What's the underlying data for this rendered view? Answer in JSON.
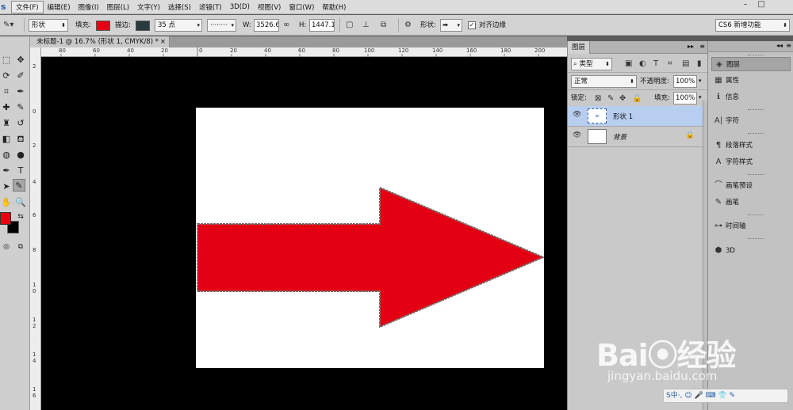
{
  "app": {
    "logo": "s"
  },
  "menu": [
    "文件(F)",
    "编辑(E)",
    "图像(I)",
    "图层(L)",
    "文字(Y)",
    "选择(S)",
    "滤镜(T)",
    "3D(D)",
    "视图(V)",
    "窗口(W)",
    "帮助(H)"
  ],
  "window_controls": [
    "–",
    "□"
  ],
  "options": {
    "mode": "形状",
    "fill_label": "填充:",
    "fill_color": "#e30012",
    "stroke_label": "描边:",
    "stroke_color": "#2a3b3f",
    "stroke_width": "35 点",
    "stroke_style": "········",
    "w_label": "W:",
    "w_value": "3526.6",
    "h_label": "H:",
    "h_value": "1447.1",
    "shape_label": "形状:",
    "align_edges_label": "对齐边缘",
    "align_edges_checked": "✓",
    "workspace": "CS6 新增功能"
  },
  "document": {
    "tab_title": "未标题-1 @ 16.7% (形状 1, CMYK/8) *",
    "close": "×",
    "ruler_top": [
      "80",
      "60",
      "40",
      "20",
      "0",
      "20",
      "40",
      "60",
      "80",
      "100",
      "120",
      "140",
      "160",
      "180",
      "200"
    ],
    "ruler_left": [
      "2",
      "0",
      "2",
      "4",
      "6",
      "8",
      "1 0",
      "1 2",
      "1 4",
      "1 6"
    ],
    "arrow_color": "#e30012"
  },
  "layers_panel": {
    "tab": "图层",
    "filter_type": "类型",
    "blend_mode": "正常",
    "opacity_label": "不透明度:",
    "opacity_value": "100%",
    "lock_label": "锁定:",
    "fill_label": "填充:",
    "fill_value": "100%",
    "layers": [
      {
        "name": "形状 1",
        "selected": true
      },
      {
        "name": "背景",
        "locked": true
      }
    ]
  },
  "dock": {
    "items": [
      {
        "icon": "layers-icon",
        "label": "图层"
      },
      {
        "icon": "properties-icon",
        "label": "属性"
      },
      {
        "icon": "info-icon",
        "label": "信息"
      },
      {
        "icon": "character-icon",
        "label": "字符"
      },
      {
        "icon": "paragraph-styles-icon",
        "label": "段落样式"
      },
      {
        "icon": "character-styles-icon",
        "label": "字符样式"
      },
      {
        "icon": "brush-presets-icon",
        "label": "画笔预设"
      },
      {
        "icon": "brush-icon",
        "label": "画笔"
      },
      {
        "icon": "timeline-icon",
        "label": "时间轴"
      },
      {
        "icon": "3d-icon",
        "label": "3D"
      }
    ]
  },
  "watermark": {
    "logo": "Bai⦿经验",
    "url": "jingyan.baidu.com"
  },
  "ime": {
    "text": "S中·, ☺ 🎤 ⌨ 👕 ✎"
  }
}
